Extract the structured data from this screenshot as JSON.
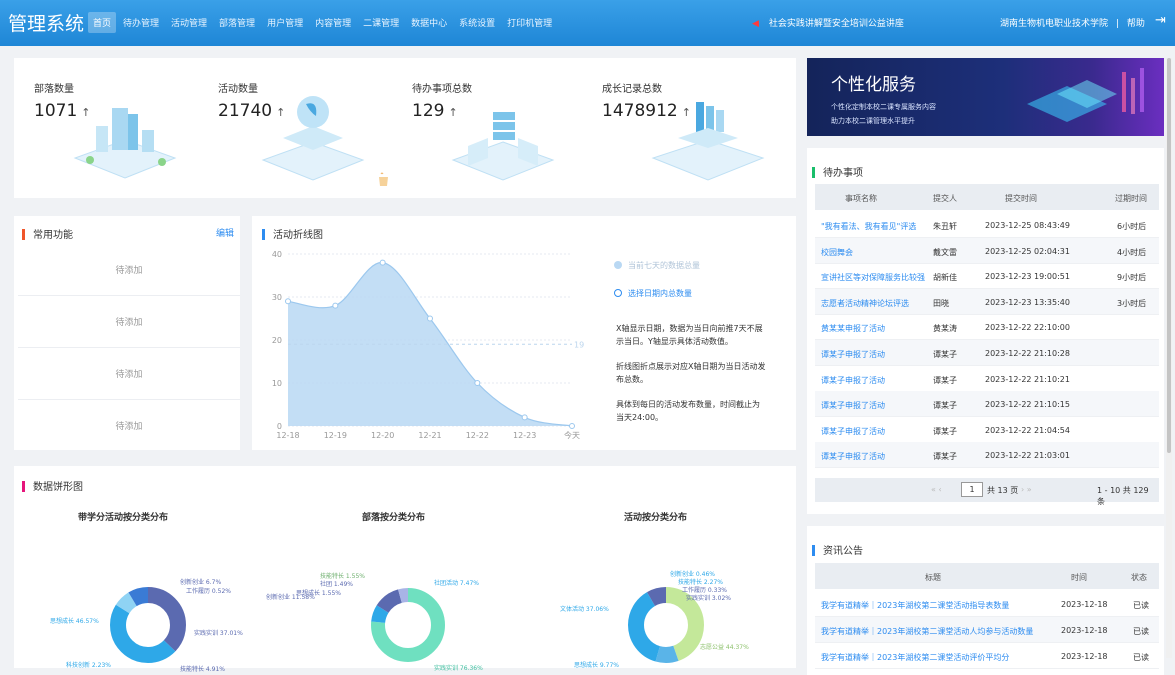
{
  "header": {
    "app_title": "管理系统",
    "nav": [
      "首页",
      "待办管理",
      "活动管理",
      "部落管理",
      "用户管理",
      "内容管理",
      "二课管理",
      "数据中心",
      "系统设置",
      "打印机管理"
    ],
    "notice": "社会实践讲解暨安全培训公益讲座",
    "school": "湖南生物机电职业技术学院",
    "help": "帮助"
  },
  "stats": [
    {
      "label": "部落数量",
      "value": "1071"
    },
    {
      "label": "活动数量",
      "value": "21740"
    },
    {
      "label": "待办事项总数",
      "value": "129"
    },
    {
      "label": "成长记录总数",
      "value": "1478912"
    }
  ],
  "quick": {
    "title": "常用功能",
    "edit": "编辑",
    "items": [
      "待添加",
      "待添加",
      "待添加",
      "待添加"
    ]
  },
  "line_chart": {
    "title": "活动折线图",
    "legend": [
      "当前七天的数据总量",
      "选择日期内总数量"
    ],
    "desc1": "X轴显示日期，数据为当日向前推7天不展示当日。Y轴显示具体活动数值。",
    "desc2": "折线图折点展示对应X轴日期为当日活动发布总数。",
    "desc3": "具体到每日的活动发布数量，时间截止为当天24:00。",
    "marker": "19"
  },
  "chart_data": {
    "type": "area",
    "categories": [
      "12-18",
      "12-19",
      "12-20",
      "12-21",
      "12-22",
      "12-23",
      "今天"
    ],
    "values": [
      29,
      28,
      38,
      25,
      10,
      2,
      0
    ],
    "ylim": [
      0,
      40
    ],
    "yticks": [
      0,
      10,
      20,
      30,
      40
    ],
    "grid": true
  },
  "pies": {
    "title": "数据饼形图",
    "charts": [
      {
        "title": "带学分活动按分类分布",
        "labels": [
          "创新创业 6.7%",
          "工作履历 0.52%",
          "实践实训 37.01%",
          "技能特长 4.91%",
          "科技创新 2.23%",
          "思想成长 46.57%"
        ]
      },
      {
        "title": "部落按分类分布",
        "labels": [
          "技能特长 1.55%",
          "社团 1.49%",
          "思想成长 1.55%",
          "创新创业 11.58%",
          "社团活动 7.47%",
          "实践实训 76.36%"
        ]
      },
      {
        "title": "活动按分类分布",
        "labels": [
          "创新创业 0.46%",
          "技能特长 2.27%",
          "工作履历 0.33%",
          "实践实训 3.02%",
          "文体活动 37.06%",
          "志愿公益 44.37%",
          "思想成长 9.77%"
        ]
      }
    ]
  },
  "service": {
    "title": "个性化服务",
    "line1": "个性化定制本校二课专属服务内容",
    "line2": "助力本校二课管理水平提升"
  },
  "todo": {
    "title": "待办事项",
    "columns": [
      "事项名称",
      "提交人",
      "提交时间",
      "过期时间"
    ],
    "rows": [
      {
        "name": "\"我有看法、我有看见\"评选",
        "by": "朱丑轩",
        "time": "2023-12-25 08:43:49",
        "exp": "6小时后"
      },
      {
        "name": "校园舞会",
        "by": "戴文雷",
        "time": "2023-12-25 02:04:31",
        "exp": "4小时后"
      },
      {
        "name": "宣讲社区等对保障服务比较强",
        "by": "胡新佳",
        "time": "2023-12-23 19:00:51",
        "exp": "9小时后"
      },
      {
        "name": "志愿者活动精神论坛评选",
        "by": "田晓",
        "time": "2023-12-23 13:35:40",
        "exp": "3小时后"
      },
      {
        "name": "黄某某申报了活动",
        "by": "黄某涛",
        "time": "2023-12-22 22:10:00",
        "exp": ""
      },
      {
        "name": "谭某子申报了活动",
        "by": "谭某子",
        "time": "2023-12-22 21:10:28",
        "exp": ""
      },
      {
        "name": "谭某子申报了活动",
        "by": "谭某子",
        "time": "2023-12-22 21:10:21",
        "exp": ""
      },
      {
        "name": "谭某子申报了活动",
        "by": "谭某子",
        "time": "2023-12-22 21:10:15",
        "exp": ""
      },
      {
        "name": "谭某子申报了活动",
        "by": "谭某子",
        "time": "2023-12-22 21:04:54",
        "exp": ""
      },
      {
        "name": "谭某子申报了活动",
        "by": "谭某子",
        "time": "2023-12-22 21:03:01",
        "exp": ""
      }
    ],
    "page": "1",
    "total_pages": "共 13 页",
    "range": "1 - 10  共 129 条"
  },
  "news": {
    "title": "资讯公告",
    "columns": [
      "标题",
      "时间",
      "状态"
    ],
    "rows": [
      {
        "title": "我学有道精举｜2023年湖校第二课堂活动指导表数量",
        "date": "2023-12-18",
        "status": "已读"
      },
      {
        "title": "我学有道精举｜2023年湖校第二课堂活动人均参与活动数量",
        "date": "2023-12-18",
        "status": "已读"
      },
      {
        "title": "我学有道精举｜2023年湖校第二课堂活动评价平均分",
        "date": "2023-12-18",
        "status": "已读"
      }
    ]
  }
}
